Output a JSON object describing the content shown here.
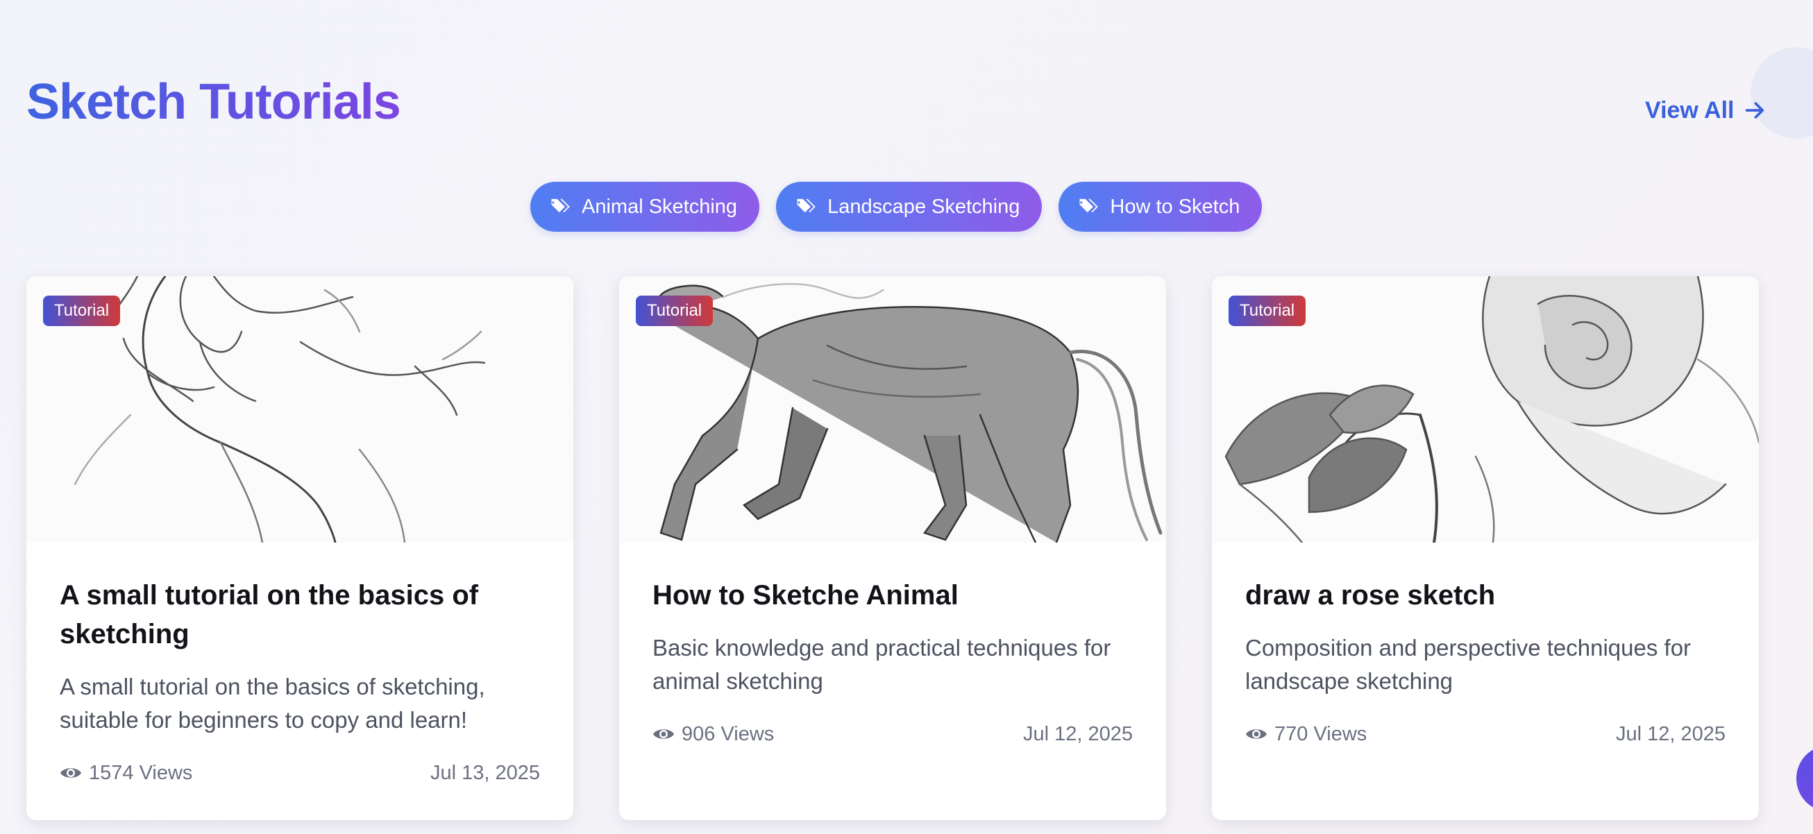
{
  "header": {
    "title": "Sketch Tutorials",
    "view_all_label": "View All",
    "view_all_icon": "arrow-right-icon"
  },
  "tags": [
    {
      "label": "Animal Sketching",
      "icon": "tags-icon"
    },
    {
      "label": "Landscape Sketching",
      "icon": "tags-icon"
    },
    {
      "label": "How to Sketch",
      "icon": "tags-icon"
    }
  ],
  "cards": [
    {
      "badge": "Tutorial",
      "title": "A small tutorial on the basics of sketching",
      "description": "A small tutorial on the basics of sketching, suitable for beginners to copy and learn!",
      "views": "1574 Views",
      "date": "Jul 13, 2025",
      "image": "hand-sketch-image"
    },
    {
      "badge": "Tutorial",
      "title": "How to Sketche Animal",
      "description": "Basic knowledge and practical techniques for animal sketching",
      "views": "906 Views",
      "date": "Jul 12, 2025",
      "image": "horse-sketch-image"
    },
    {
      "badge": "Tutorial",
      "title": "draw a rose sketch",
      "description": "Composition and perspective techniques for landscape sketching",
      "views": "770 Views",
      "date": "Jul 12, 2025",
      "image": "rose-sketch-image"
    }
  ],
  "colors": {
    "title_gradient_start": "#3f63e0",
    "title_gradient_end": "#7c45e2",
    "link": "#3a60dc",
    "tag_gradient_start": "#4f7ef2",
    "tag_gradient_end": "#8f5ce9",
    "badge_gradient_start": "#4452d4",
    "badge_gradient_end": "#cf3a3a"
  }
}
